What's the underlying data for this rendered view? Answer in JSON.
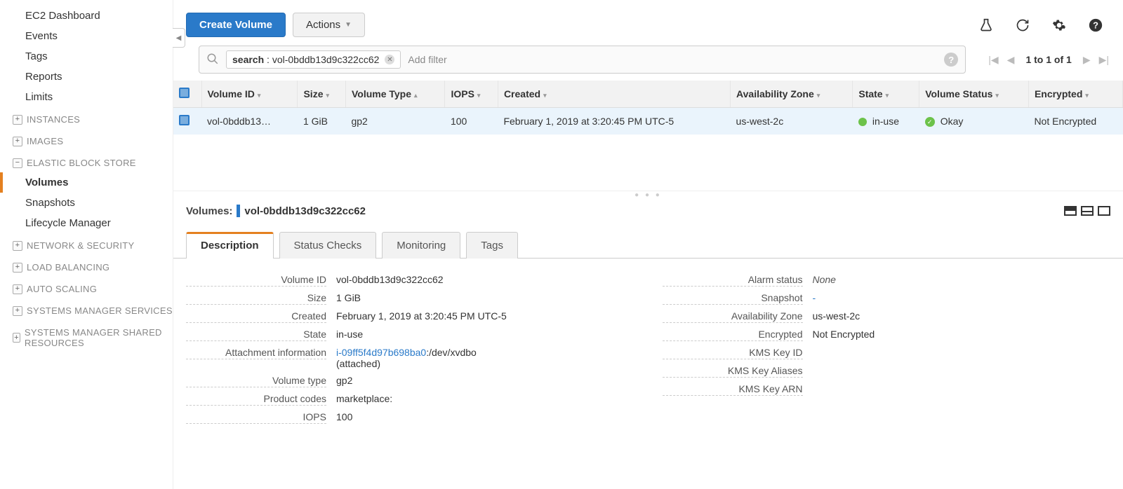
{
  "sidebar": {
    "top": [
      "EC2 Dashboard",
      "Events",
      "Tags",
      "Reports",
      "Limits"
    ],
    "sections": [
      {
        "label": "INSTANCES",
        "expanded": false
      },
      {
        "label": "IMAGES",
        "expanded": false
      },
      {
        "label": "ELASTIC BLOCK STORE",
        "expanded": true,
        "items": [
          "Volumes",
          "Snapshots",
          "Lifecycle Manager"
        ],
        "active": "Volumes"
      },
      {
        "label": "NETWORK & SECURITY",
        "expanded": false
      },
      {
        "label": "LOAD BALANCING",
        "expanded": false
      },
      {
        "label": "AUTO SCALING",
        "expanded": false
      },
      {
        "label": "SYSTEMS MANAGER SERVICES",
        "expanded": false
      },
      {
        "label": "SYSTEMS MANAGER SHARED RESOURCES",
        "expanded": false
      }
    ]
  },
  "toolbar": {
    "create_label": "Create Volume",
    "actions_label": "Actions"
  },
  "search": {
    "tag_key": "search",
    "tag_value": "vol-0bddb13d9c322cc62",
    "add_filter": "Add filter"
  },
  "pagination": "1 to 1 of 1",
  "table": {
    "headers": [
      "Volume ID",
      "Size",
      "Volume Type",
      "IOPS",
      "Created",
      "Availability Zone",
      "State",
      "Volume Status",
      "Encrypted"
    ],
    "row": {
      "volume_id": "vol-0bddb13…",
      "size": "1 GiB",
      "volume_type": "gp2",
      "iops": "100",
      "created": "February 1, 2019 at 3:20:45 PM UTC-5",
      "az": "us-west-2c",
      "state": "in-use",
      "volume_status": "Okay",
      "encrypted": "Not Encrypted"
    }
  },
  "detail": {
    "title_prefix": "Volumes:",
    "volume_id": "vol-0bddb13d9c322cc62",
    "tabs": [
      "Description",
      "Status Checks",
      "Monitoring",
      "Tags"
    ],
    "left": [
      {
        "label": "Volume ID",
        "value": "vol-0bddb13d9c322cc62"
      },
      {
        "label": "Size",
        "value": "1 GiB"
      },
      {
        "label": "Created",
        "value": "February 1, 2019 at 3:20:45 PM UTC-5"
      },
      {
        "label": "State",
        "value": "in-use"
      },
      {
        "label": "Attachment information",
        "link": "i-09ff5f4d97b698ba0",
        "suffix": ":/dev/xvdbo",
        "sub": "(attached)"
      },
      {
        "label": "Volume type",
        "value": "gp2"
      },
      {
        "label": "Product codes",
        "value": "marketplace:"
      },
      {
        "label": "IOPS",
        "value": "100"
      }
    ],
    "right": [
      {
        "label": "Alarm status",
        "value": "None",
        "italic": true
      },
      {
        "label": "Snapshot",
        "value": "-",
        "link": true
      },
      {
        "label": "Availability Zone",
        "value": "us-west-2c"
      },
      {
        "label": "Encrypted",
        "value": "Not Encrypted"
      },
      {
        "label": "KMS Key ID",
        "value": ""
      },
      {
        "label": "KMS Key Aliases",
        "value": ""
      },
      {
        "label": "KMS Key ARN",
        "value": ""
      }
    ]
  }
}
